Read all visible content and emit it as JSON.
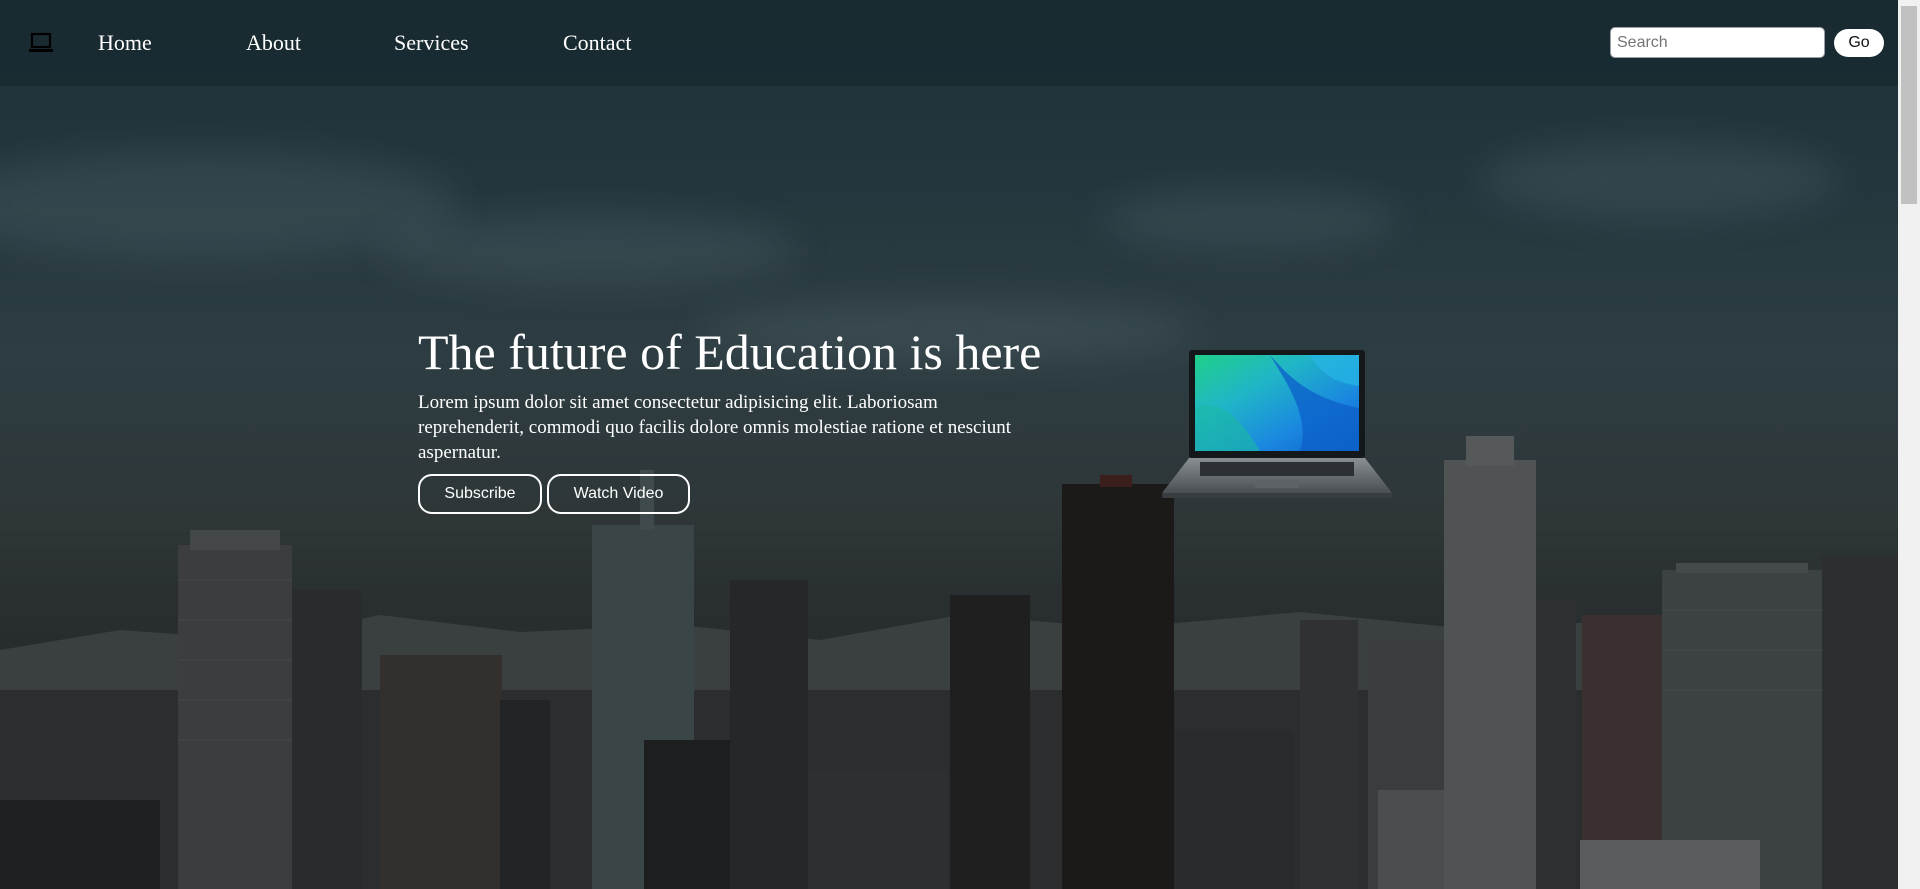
{
  "nav": {
    "logo_icon": "laptop-icon",
    "links": [
      "Home",
      "About",
      "Services",
      "Contact"
    ]
  },
  "search": {
    "placeholder": "Search",
    "value": "",
    "go_label": "Go"
  },
  "hero": {
    "title": "The future of Education is here",
    "text": "Lorem ipsum dolor sit amet consectetur adipisicing elit. Laboriosam reprehenderit, commodi quo facilis dolore omnis molestiae ratione et nesciunt aspernatur.",
    "subscribe_label": "Subscribe",
    "watch_label": "Watch Video",
    "image_icon": "laptop-image"
  },
  "colors": {
    "text": "#ffffff",
    "navbar_bg": "#14262c",
    "button_border": "#ffffff"
  }
}
